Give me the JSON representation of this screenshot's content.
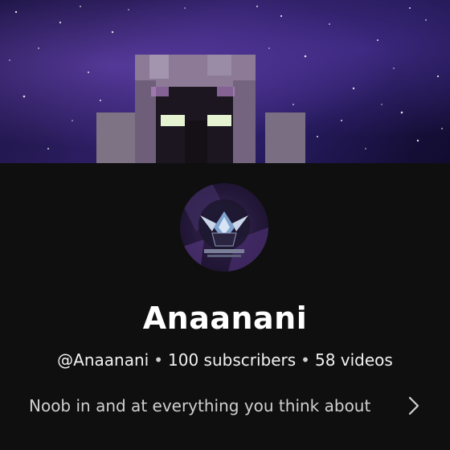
{
  "channel": {
    "name": "Anaanani",
    "handle": "@Anaanani",
    "subscribers": "100 subscribers",
    "videos": "58 videos",
    "separator": "•",
    "description": "Noob in and at everything you think about"
  },
  "icons": {
    "description_expand": "chevron-right-icon"
  },
  "colors": {
    "background": "#0f0f0f",
    "text_primary": "#ffffff",
    "text_secondary": "#d0d0d0"
  }
}
